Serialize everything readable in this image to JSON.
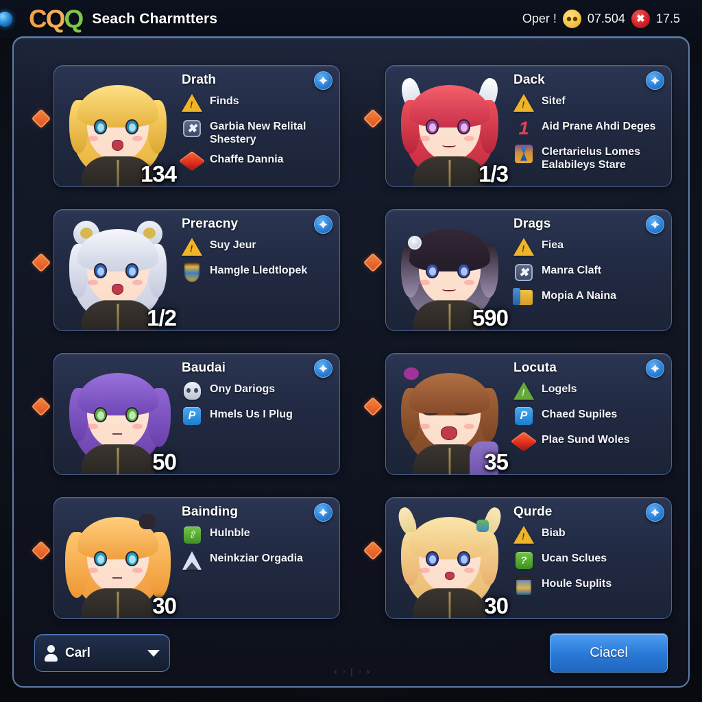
{
  "topbar": {
    "logo": {
      "part1": "C",
      "part2": "Q",
      "part3": "Q"
    },
    "title": "Seach Charmtters",
    "status_left_label": "Oper !",
    "status_neutral_icon": "neutral-face-icon",
    "status_neutral_value": "07.504",
    "status_alert_icon": "alert-badge-icon",
    "status_alert_value": "17.5"
  },
  "cards": [
    {
      "name": "Drath",
      "level": "134",
      "close_label": "✖",
      "attrs": [
        {
          "icon": "warning-triangle-icon",
          "text": "Finds"
        },
        {
          "icon": "safe-box-icon",
          "text": "Garbia New Relital Shestery"
        },
        {
          "icon": "red-gem-icon",
          "text": "Chaffe Dannia"
        }
      ]
    },
    {
      "name": "Dack",
      "level": "1/3",
      "close_label": "✖",
      "attrs": [
        {
          "icon": "warning-triangle-icon",
          "text": "Sitef"
        },
        {
          "icon": "numeral-one-icon",
          "text": "Aid Prane Ahdi Deges"
        },
        {
          "icon": "hourglass-icon",
          "text": "Clertarielus Lomes Ealabileys Stare"
        }
      ]
    },
    {
      "name": "Preracny",
      "level": "1/2",
      "close_label": "✖",
      "attrs": [
        {
          "icon": "warning-triangle-icon",
          "text": "Suy Jeur"
        },
        {
          "icon": "trophy-icon",
          "text": "Hamgle Lledtlopek"
        }
      ]
    },
    {
      "name": "Drags",
      "level": "590",
      "close_label": "✖",
      "attrs": [
        {
          "icon": "warning-triangle-icon",
          "text": "Fiea"
        },
        {
          "icon": "safe-box-icon",
          "text": "Manra Claft"
        },
        {
          "icon": "folder-icon",
          "text": "Mopia A Naina"
        }
      ]
    },
    {
      "name": "Baudai",
      "level": "50",
      "close_label": "✖",
      "attrs": [
        {
          "icon": "skull-icon",
          "text": "Ony Dariogs"
        },
        {
          "icon": "parking-p-icon",
          "text": "Hmels Us I Plug"
        }
      ]
    },
    {
      "name": "Locuta",
      "level": "35",
      "close_label": "✖",
      "attrs": [
        {
          "icon": "green-warning-triangle-icon",
          "text": "Logels"
        },
        {
          "icon": "parking-p-icon",
          "text": "Chaed Supiles"
        },
        {
          "icon": "red-gem-icon",
          "text": "Plae Sund Woles"
        }
      ]
    },
    {
      "name": "Bainding",
      "level": "30",
      "close_label": "✖",
      "attrs": [
        {
          "icon": "green-arrow-up-icon",
          "text": "Hulnble"
        },
        {
          "icon": "dart-arrow-icon",
          "text": "Neinkziar Orgadia"
        }
      ]
    },
    {
      "name": "Qurde",
      "level": "30",
      "close_label": "✖",
      "attrs": [
        {
          "icon": "warning-triangle-icon",
          "text": "Biab"
        },
        {
          "icon": "green-question-icon",
          "text": "Ucan Sclues"
        },
        {
          "icon": "jar-icon",
          "text": "Houle Suplits"
        }
      ]
    }
  ],
  "bottombar": {
    "user_name": "Carl",
    "user_icon": "person-icon",
    "caret_icon": "chevron-down-icon",
    "pager": "‹ ◦ | ◦ ›",
    "cancel_label": "Ciacel"
  },
  "colors": {
    "accent_blue": "#2a7ad8",
    "panel_border": "#5f7ba8",
    "card_border": "#4d6492",
    "diamond": "#e25420",
    "logo_orange": "#f0a24a",
    "logo_green": "#7dc64a"
  }
}
